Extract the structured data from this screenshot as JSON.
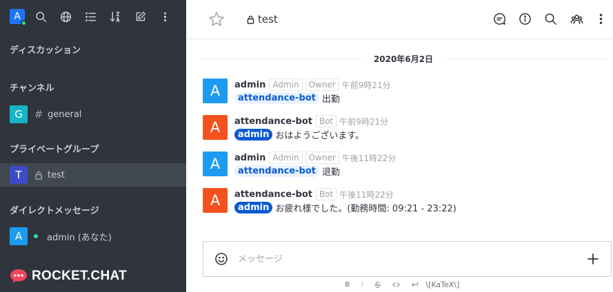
{
  "sidebar": {
    "user_avatar": "A",
    "toolbar_icons": [
      "search-icon",
      "globe-icon",
      "list-icon",
      "sort-icon",
      "edit-icon",
      "kebab-icon"
    ],
    "sections": {
      "discussion": "ディスカッション",
      "channels": "チャンネル",
      "private_groups": "プライベートグループ",
      "direct_messages": "ダイレクトメッセージ"
    },
    "items": [
      {
        "avatar": "G",
        "avatar_color": "#16b4c4",
        "kind": "#",
        "name": "general"
      },
      {
        "avatar": "T",
        "avatar_color": "#3c4cc4",
        "kind": "lock",
        "name": "test"
      },
      {
        "avatar": "A",
        "avatar_color": "#1d9bf0",
        "kind": "status",
        "name": "admin (あなた)"
      }
    ],
    "logo_text": "ROCKET.CHAT"
  },
  "header": {
    "room_name": "test",
    "icons": [
      "discussion-icon",
      "info-icon",
      "search-icon",
      "team-icon",
      "kebab-icon"
    ]
  },
  "day_separator": "2020年6月2日",
  "messages": [
    {
      "avatar": "A",
      "avatar_color": "#1d9bf0",
      "user": "admin",
      "roles": [
        "Admin",
        "Owner"
      ],
      "time": "午前9時21分",
      "mention": "attendance-bot",
      "mention_is_me": false,
      "text": "出勤"
    },
    {
      "avatar": "A",
      "avatar_color": "#f4511e",
      "user": "attendance-bot",
      "roles": [
        "Bot"
      ],
      "time": "午前9時21分",
      "mention": "admin",
      "mention_is_me": true,
      "text": "おはようございます。"
    },
    {
      "avatar": "A",
      "avatar_color": "#1d9bf0",
      "user": "admin",
      "roles": [
        "Admin",
        "Owner"
      ],
      "time": "午後11時22分",
      "mention": "attendance-bot",
      "mention_is_me": false,
      "text": "退勤"
    },
    {
      "avatar": "A",
      "avatar_color": "#f4511e",
      "user": "attendance-bot",
      "roles": [
        "Bot"
      ],
      "time": "午後11時22分",
      "mention": "admin",
      "mention_is_me": true,
      "text": "お疲れ様でした。(勤務時間: 09:21 - 23:22)"
    }
  ],
  "composer": {
    "placeholder": "メッセージ",
    "format_labels": {
      "bold": "B",
      "italic": "i",
      "katex": "\\[KaTeX\\]"
    }
  },
  "colors": {
    "sidebar_bg": "#2f343d",
    "active_item_bg": "#414852",
    "online": "#2de0a5",
    "mention_blue": "#095ad2",
    "logo_red": "#f5455c"
  }
}
